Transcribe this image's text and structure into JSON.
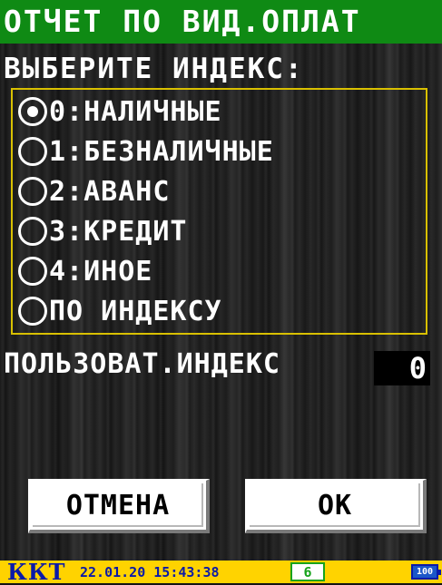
{
  "header": {
    "title": "ОТЧЕТ ПО ВИД.ОПЛАТ"
  },
  "prompt": "ВЫБЕРИТЕ ИНДЕКС:",
  "options": [
    {
      "label": "0:НАЛИЧНЫЕ",
      "selected": true
    },
    {
      "label": "1:БЕЗНАЛИЧНЫЕ",
      "selected": false
    },
    {
      "label": "2:АВАНС",
      "selected": false
    },
    {
      "label": "3:КРЕДИТ",
      "selected": false
    },
    {
      "label": "4:ИНОЕ",
      "selected": false
    },
    {
      "label": "ПО ИНДЕКСУ",
      "selected": false
    }
  ],
  "user_index": {
    "label": "ПОЛЬЗОВАТ.ИНДЕКС",
    "value": "0"
  },
  "buttons": {
    "cancel": "ОТМЕНА",
    "ok": "ОК"
  },
  "status": {
    "device": "ККТ",
    "datetime": "22.01.20 15:43:38",
    "shift": "6",
    "battery": "100"
  },
  "colors": {
    "title_bar": "#0f8a14",
    "option_border": "#d9c000",
    "status_bar": "#ffd300",
    "status_text": "#0a1aa8",
    "shift_border": "#17a31c",
    "battery_fill": "#1b57c9"
  }
}
